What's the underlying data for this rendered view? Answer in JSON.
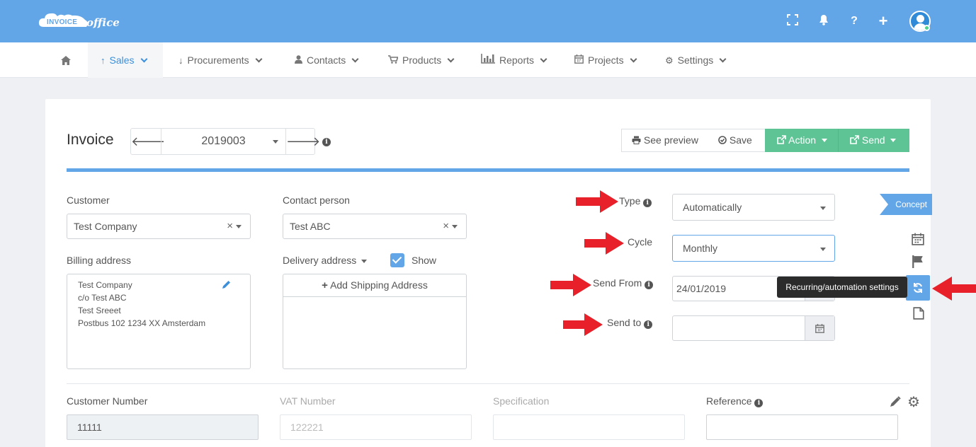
{
  "header": {
    "logo_word": "INVOICE",
    "logo_office": "office",
    "icons": [
      "fullscreen-icon",
      "bell-icon",
      "help-icon",
      "plus-icon",
      "user-avatar"
    ]
  },
  "nav": {
    "home_icon": "home-icon",
    "items": [
      {
        "label": "Sales",
        "icon": "arrow-up-icon"
      },
      {
        "label": "Procurements",
        "icon": "arrow-down-icon"
      },
      {
        "label": "Contacts",
        "icon": "user-icon"
      },
      {
        "label": "Products",
        "icon": "cart-icon"
      },
      {
        "label": "Reports",
        "icon": "bar-chart-icon"
      },
      {
        "label": "Projects",
        "icon": "calendar-icon"
      },
      {
        "label": "Settings",
        "icon": "gear-icon"
      }
    ]
  },
  "invoice": {
    "title": "Invoice",
    "number": "2019003"
  },
  "toolbar": {
    "preview": "See preview",
    "save": "Save",
    "action": "Action",
    "send": "Send"
  },
  "form": {
    "customer_label": "Customer",
    "customer_value": "Test Company",
    "contact_label": "Contact person",
    "contact_value": "Test ABC",
    "billing_label": "Billing address",
    "billing_lines": [
      "Test Company",
      "c/o Test ABC",
      "Test Sreeet",
      "Postbus 102 1234 XX Amsterdam"
    ],
    "delivery_label": "Delivery address",
    "show_label": "Show",
    "add_shipping": "Add Shipping Address",
    "type_label": "Type",
    "type_value": "Automatically",
    "cycle_label": "Cycle",
    "cycle_value": "Monthly",
    "send_from_label": "Send From",
    "send_from_value": "24/01/2019",
    "send_to_label": "Send to",
    "send_to_value": ""
  },
  "status": {
    "badge": "Concept",
    "tooltip": "Recurring/automation settings"
  },
  "bottom": {
    "customer_number_label": "Customer Number",
    "customer_number_value": "11111",
    "vat_label": "VAT Number",
    "vat_value": "122221",
    "specification_label": "Specification",
    "reference_label": "Reference"
  },
  "colors": {
    "topbar": "#63a6e8",
    "accent": "#63a6e8",
    "green": "#5fc495",
    "annotation_arrow": "#e8202a"
  }
}
